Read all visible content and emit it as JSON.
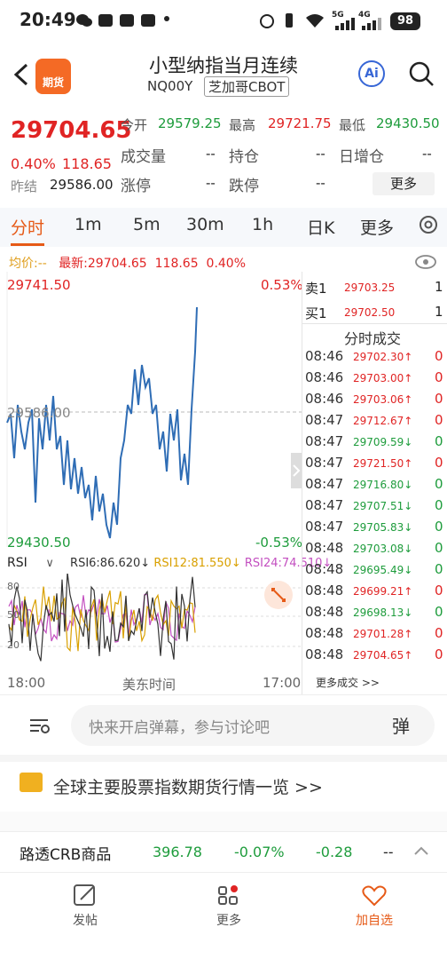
{
  "status": {
    "time": "20:49",
    "icons": [
      "wechat-icon",
      "taobao-icon",
      "app-icon",
      "app2-icon",
      "dot-icon"
    ],
    "battery": "98",
    "net1": "5G",
    "net2": "4G"
  },
  "header": {
    "title": "小型纳指当月连续",
    "code": "NQ00Y",
    "exchange": "芝加哥CBOT",
    "logo_text": "期货",
    "ai_label": "Ai"
  },
  "quote": {
    "price": "29704.65",
    "pct": "0.40%",
    "change": "118.65",
    "prev_close_label": "昨结",
    "prev_close": "29586.00",
    "open_label": "今开",
    "open": "29579.25",
    "high_label": "最高",
    "high": "29721.75",
    "low_label": "最低",
    "low": "29430.50",
    "volume_label": "成交量",
    "volume": "--",
    "oi_label": "持仓",
    "oi": "--",
    "daily_oi_label": "日增仓",
    "daily_oi": "--",
    "limit_up_label": "涨停",
    "limit_up": "--",
    "limit_down_label": "跌停",
    "limit_down": "--",
    "more_label": "更多"
  },
  "tabs": [
    "分时",
    "1m",
    "5m",
    "30m",
    "1h",
    "日K",
    "更多"
  ],
  "chart_info": {
    "avg": "均价:--",
    "latest": "最新:29704.65",
    "chg": "118.65",
    "pct": "0.40%",
    "top_price": "29741.50",
    "top_pct": "0.53%",
    "bot_price": "29430.50",
    "bot_pct": "-0.53%",
    "mid_price": "29586.00",
    "rsi_label": "RSI",
    "rsi6": "RSI6:86.620↓",
    "rsi12": "RSI12:81.550↓",
    "rsi24": "RSI24:74.510↓",
    "rsi_ticks": [
      "80",
      "50",
      "20"
    ],
    "time_start": "18:00",
    "time_mid": "美东时间",
    "time_end": "17:00"
  },
  "order_book": {
    "ask_label": "卖1",
    "ask_price": "29703.25",
    "ask_vol": "1",
    "bid_label": "买1",
    "bid_price": "29702.50",
    "bid_vol": "1",
    "ticks_title": "分时成交",
    "ticks": [
      {
        "t": "08:46",
        "p": "29702.30↑",
        "v": "0"
      },
      {
        "t": "08:46",
        "p": "29703.00↑",
        "v": "0"
      },
      {
        "t": "08:46",
        "p": "29703.06↑",
        "v": "0"
      },
      {
        "t": "08:47",
        "p": "29712.67↑",
        "v": "0"
      },
      {
        "t": "08:47",
        "p": "29709.59↓",
        "v": "0"
      },
      {
        "t": "08:47",
        "p": "29721.50↑",
        "v": "0"
      },
      {
        "t": "08:47",
        "p": "29716.80↓",
        "v": "0"
      },
      {
        "t": "08:47",
        "p": "29707.51↓",
        "v": "0"
      },
      {
        "t": "08:47",
        "p": "29705.83↓",
        "v": "0"
      },
      {
        "t": "08:48",
        "p": "29703.08↓",
        "v": "0"
      },
      {
        "t": "08:48",
        "p": "29695.49↓",
        "v": "0"
      },
      {
        "t": "08:48",
        "p": "29699.21↑",
        "v": "0"
      },
      {
        "t": "08:48",
        "p": "29698.13↓",
        "v": "0"
      },
      {
        "t": "08:48",
        "p": "29701.28↑",
        "v": "0"
      },
      {
        "t": "08:48",
        "p": "29704.65↑",
        "v": "0"
      }
    ],
    "more_trades": "更多成交 >>"
  },
  "comment": {
    "placeholder": "快来开启弹幕，参与讨论吧",
    "danmu": "弹"
  },
  "overview": {
    "text": "全球主要股票指数期货行情一览 >>"
  },
  "ticker": {
    "name": "路透CRB商品",
    "price": "396.78",
    "pct": "-0.07%",
    "chg": "-0.28",
    "extra": "--"
  },
  "nav": {
    "post": "发帖",
    "more": "更多",
    "fav": "加自选"
  },
  "colors": {
    "up": "#e02424",
    "down": "#1e9c3c",
    "accent": "#e65a17",
    "line": "#2f6db5"
  }
}
